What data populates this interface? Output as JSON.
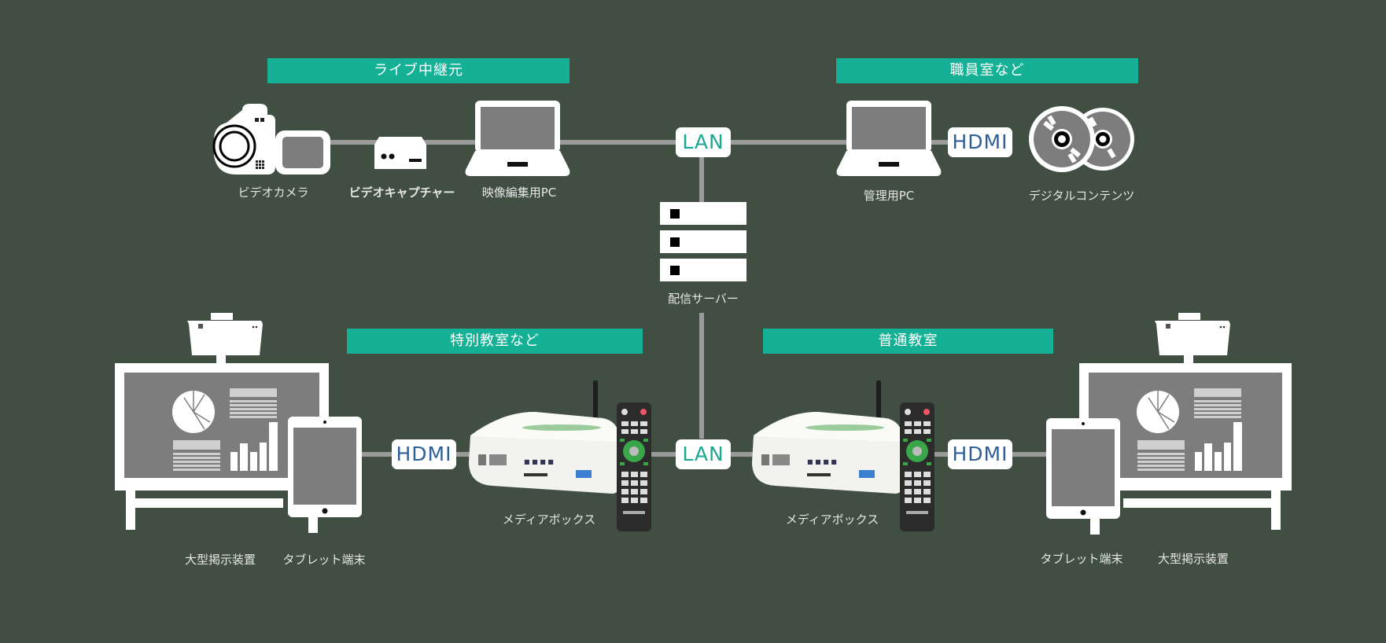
{
  "colors": {
    "background": "#404f42",
    "banner": "#14b197",
    "connector": "#9a9a9a",
    "lan_text": "#1aa892",
    "hdmi_text": "#2f5f98"
  },
  "zones": {
    "live_source": "ライブ中継元",
    "staff_room": "職員室など",
    "special_classroom": "特別教室など",
    "regular_classroom": "普通教室"
  },
  "devices": {
    "video_camera": "ビデオカメラ",
    "video_capture": "ビデオキャプチャー",
    "editing_pc": "映像編集用PC",
    "admin_pc": "管理用PC",
    "digital_content": "デジタルコンテンツ",
    "distribution_server": "配信サーバー",
    "media_box_left": "メディアボックス",
    "media_box_right": "メディアボックス",
    "large_display_left": "大型掲示装置",
    "tablet_left": "タブレット端末",
    "tablet_right": "タブレット端末",
    "large_display_right": "大型掲示装置"
  },
  "connections": {
    "lan_top": "LAN",
    "hdmi_top": "HDMI",
    "lan_bottom": "LAN",
    "hdmi_bottom_left": "HDMI",
    "hdmi_bottom_right": "HDMI"
  }
}
